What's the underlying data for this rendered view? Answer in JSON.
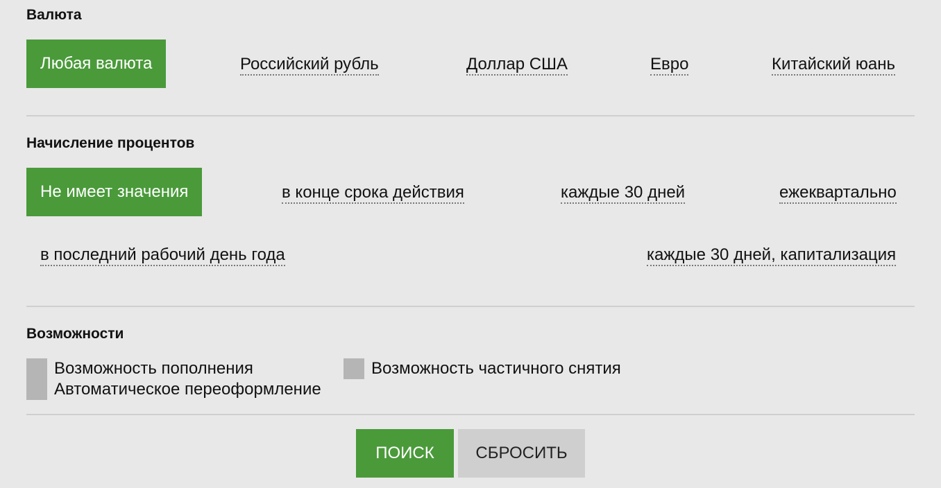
{
  "currency": {
    "heading": "Валюта",
    "selected": "Любая валюта",
    "options": [
      "Российский рубль",
      "Доллар США",
      "Евро",
      "Китайский юань"
    ]
  },
  "interest": {
    "heading": "Начисление процентов",
    "selected": "Не имеет значения",
    "options": [
      "в конце срока действия",
      "каждые 30 дней",
      "ежеквартально",
      "в последний рабочий день года",
      "каждые 30 дней, капитализация"
    ]
  },
  "features": {
    "heading": "Возможности",
    "items": [
      "Возможность пополнения",
      "Возможность частичного снятия",
      "Автоматическое переоформление"
    ]
  },
  "actions": {
    "search": "Поиск",
    "reset": "Сбросить"
  },
  "colors": {
    "accent": "#4a9a3a",
    "background": "#e8e8e8",
    "checkbox": "#b5b5b5"
  }
}
